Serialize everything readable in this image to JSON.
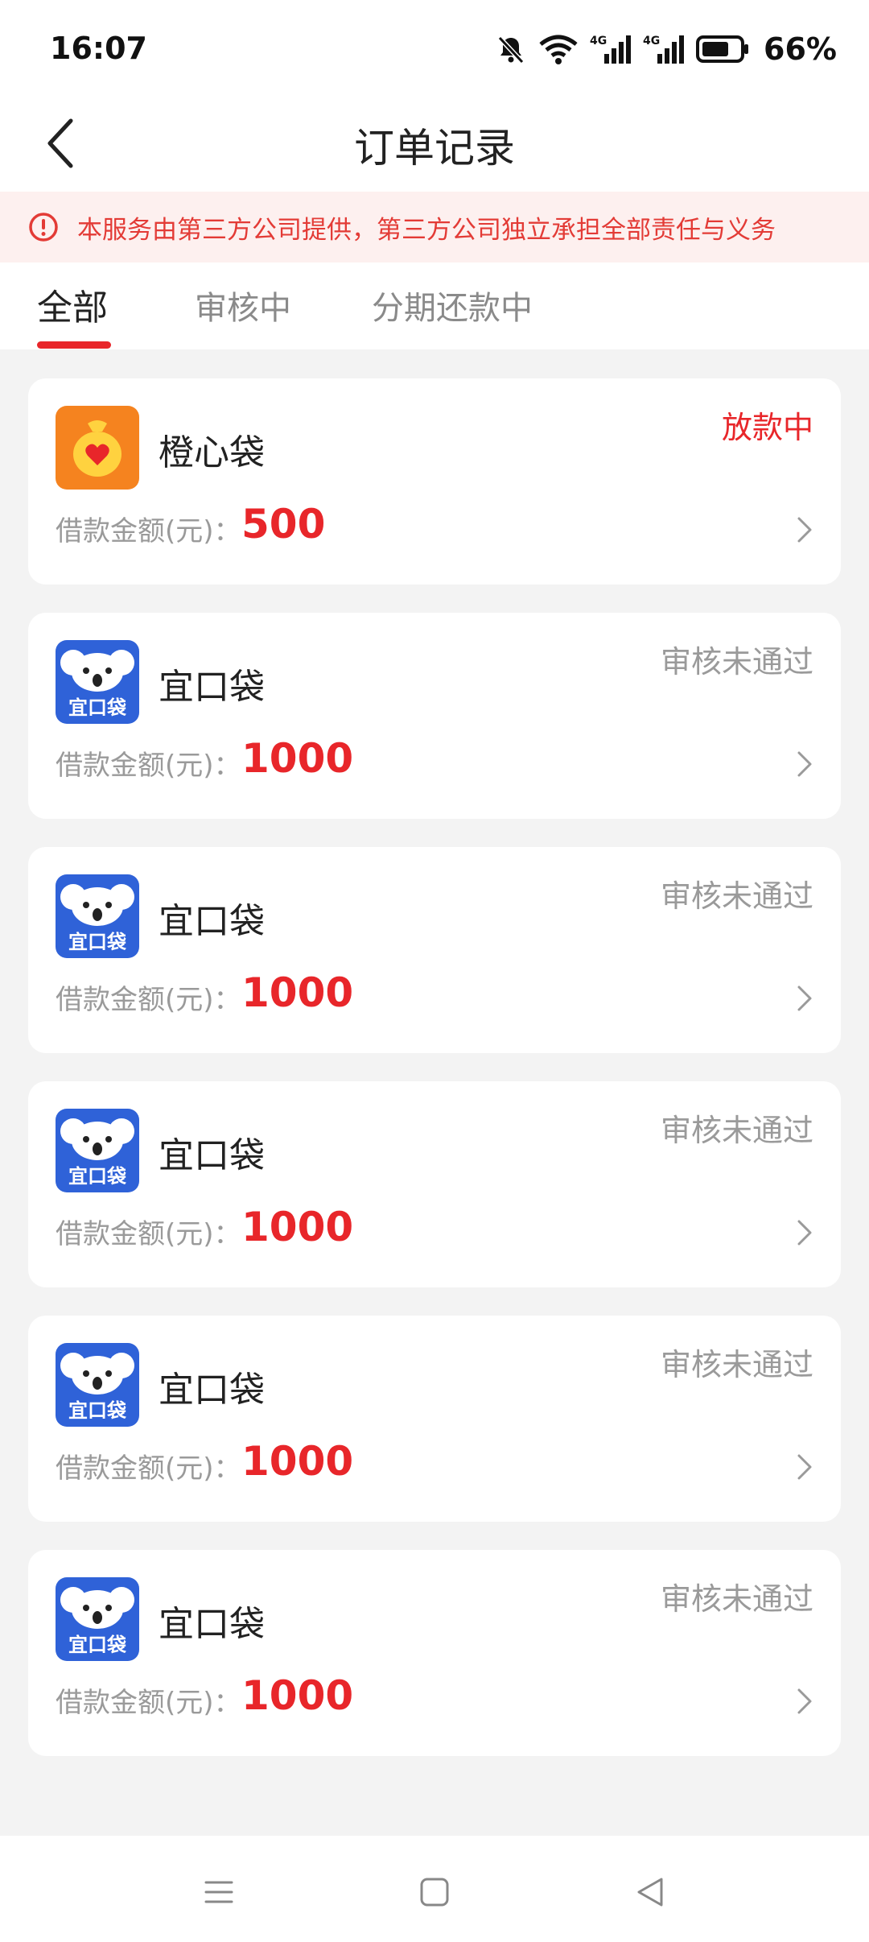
{
  "status_bar": {
    "time": "16:07",
    "battery_percent": "66%",
    "network_1": "4G",
    "network_2": "4G"
  },
  "header": {
    "title": "订单记录"
  },
  "notice": {
    "text": "本服务由第三方公司提供，第三方公司独立承担全部责任与义务"
  },
  "tabs": [
    {
      "label": "全部",
      "active": true
    },
    {
      "label": "审核中",
      "active": false
    },
    {
      "label": "分期还款中",
      "active": false
    }
  ],
  "orders": [
    {
      "name": "橙心袋",
      "status": "放款中",
      "status_color": "#e8262a",
      "amount_label": "借款金额(元)：",
      "amount": "500",
      "logo": "orange-money-bag-logo"
    },
    {
      "name": "宜口袋",
      "status": "审核未通过",
      "status_color": "#9a9a9a",
      "amount_label": "借款金额(元)：",
      "amount": "1000",
      "logo": "koala-logo",
      "logo_text": "宜口袋"
    },
    {
      "name": "宜口袋",
      "status": "审核未通过",
      "status_color": "#9a9a9a",
      "amount_label": "借款金额(元)：",
      "amount": "1000",
      "logo": "koala-logo",
      "logo_text": "宜口袋"
    },
    {
      "name": "宜口袋",
      "status": "审核未通过",
      "status_color": "#9a9a9a",
      "amount_label": "借款金额(元)：",
      "amount": "1000",
      "logo": "koala-logo",
      "logo_text": "宜口袋"
    },
    {
      "name": "宜口袋",
      "status": "审核未通过",
      "status_color": "#9a9a9a",
      "amount_label": "借款金额(元)：",
      "amount": "1000",
      "logo": "koala-logo",
      "logo_text": "宜口袋"
    },
    {
      "name": "宜口袋",
      "status": "审核未通过",
      "status_color": "#9a9a9a",
      "amount_label": "借款金额(元)：",
      "amount": "1000",
      "logo": "koala-logo",
      "logo_text": "宜口袋"
    }
  ],
  "colors": {
    "accent_red": "#e8262a",
    "notice_bg": "#fdf0ef",
    "koala_blue": "#2f62d8",
    "orange_logo": "#f5831f"
  },
  "icons": {
    "back": "chevron-left-icon",
    "notice": "alert-circle-icon",
    "row_arrow": "chevron-right-icon",
    "sys_menu": "menu-icon",
    "sys_home": "home-square-icon",
    "sys_back": "back-triangle-icon"
  }
}
